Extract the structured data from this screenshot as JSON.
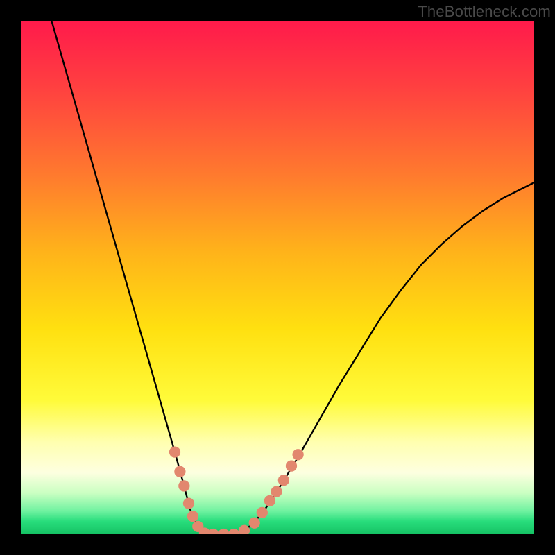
{
  "watermark": "TheBottleneck.com",
  "chart_data": {
    "type": "line",
    "title": "",
    "xlabel": "",
    "ylabel": "",
    "xlim": [
      0,
      1
    ],
    "ylim": [
      0,
      1
    ],
    "gradient_stops": [
      {
        "offset": 0.0,
        "color": "#ff1a4b"
      },
      {
        "offset": 0.13,
        "color": "#ff4040"
      },
      {
        "offset": 0.3,
        "color": "#ff7a2e"
      },
      {
        "offset": 0.45,
        "color": "#ffb31a"
      },
      {
        "offset": 0.6,
        "color": "#ffe010"
      },
      {
        "offset": 0.74,
        "color": "#fffb3a"
      },
      {
        "offset": 0.82,
        "color": "#ffffaf"
      },
      {
        "offset": 0.88,
        "color": "#fdffe0"
      },
      {
        "offset": 0.92,
        "color": "#caffc2"
      },
      {
        "offset": 0.955,
        "color": "#6ff2a0"
      },
      {
        "offset": 0.975,
        "color": "#28dd7c"
      },
      {
        "offset": 1.0,
        "color": "#15c264"
      }
    ],
    "series": [
      {
        "name": "curve",
        "x": [
          0.06,
          0.08,
          0.1,
          0.12,
          0.14,
          0.16,
          0.18,
          0.2,
          0.22,
          0.24,
          0.26,
          0.28,
          0.3,
          0.315,
          0.33,
          0.345,
          0.36,
          0.38,
          0.41,
          0.44,
          0.47,
          0.5,
          0.54,
          0.58,
          0.62,
          0.66,
          0.7,
          0.74,
          0.78,
          0.82,
          0.86,
          0.9,
          0.94,
          0.98,
          1.0
        ],
        "y": [
          1.0,
          0.93,
          0.86,
          0.79,
          0.72,
          0.65,
          0.58,
          0.51,
          0.44,
          0.37,
          0.3,
          0.23,
          0.16,
          0.105,
          0.048,
          0.015,
          0.0,
          0.0,
          0.0,
          0.01,
          0.04,
          0.085,
          0.15,
          0.22,
          0.29,
          0.355,
          0.42,
          0.475,
          0.525,
          0.565,
          0.6,
          0.63,
          0.655,
          0.675,
          0.685
        ]
      }
    ],
    "highlight_points": {
      "color": "#e2876e",
      "radius_rel": 0.011,
      "points": [
        {
          "x": 0.3,
          "y": 0.16
        },
        {
          "x": 0.31,
          "y": 0.122
        },
        {
          "x": 0.318,
          "y": 0.094
        },
        {
          "x": 0.327,
          "y": 0.06
        },
        {
          "x": 0.335,
          "y": 0.035
        },
        {
          "x": 0.345,
          "y": 0.015
        },
        {
          "x": 0.358,
          "y": 0.002
        },
        {
          "x": 0.375,
          "y": 0.0
        },
        {
          "x": 0.395,
          "y": 0.0
        },
        {
          "x": 0.415,
          "y": 0.0
        },
        {
          "x": 0.435,
          "y": 0.007
        },
        {
          "x": 0.455,
          "y": 0.022
        },
        {
          "x": 0.47,
          "y": 0.042
        },
        {
          "x": 0.485,
          "y": 0.065
        },
        {
          "x": 0.498,
          "y": 0.083
        },
        {
          "x": 0.512,
          "y": 0.105
        },
        {
          "x": 0.527,
          "y": 0.133
        },
        {
          "x": 0.54,
          "y": 0.155
        }
      ]
    }
  }
}
